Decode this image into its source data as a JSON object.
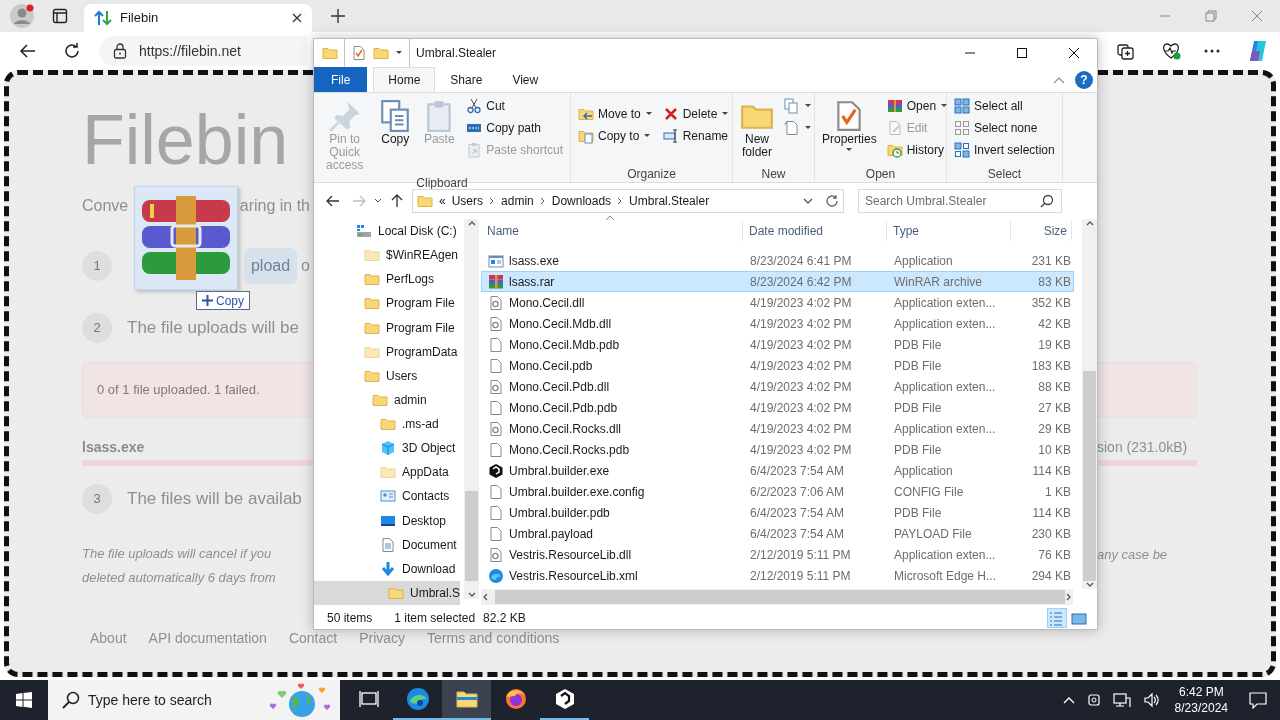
{
  "browser": {
    "tabs": [
      {
        "title": "Filebin",
        "selected": true
      }
    ],
    "url": "https://filebin.net"
  },
  "page": {
    "heading": "Filebin",
    "subtitle": [
      "Conve",
      "aring in th"
    ],
    "step_1": {
      "number": "1",
      "button": "pload",
      "after": "o"
    },
    "step_2": {
      "number": "2",
      "text": "The file uploads will be"
    },
    "error": "0 of 1 file uploaded. 1 failed.",
    "file": {
      "name": "lsass.exe",
      "size": "sion (231.0kB)",
      "level": 1
    },
    "step_3": {
      "number": "3",
      "text": "The files will be availab"
    },
    "note": {
      "lines": [
        "The file uploads will cancel if you",
        "deleted automatically 6 days from"
      ],
      "right": "any case be"
    },
    "footer": [
      "About",
      "API documentation",
      "Contact",
      "Privacy",
      "Terms and conditions"
    ]
  },
  "drag": {
    "label": "Copy"
  },
  "explorer": {
    "title": "Umbral.Stealer",
    "ribbon_tabs": [
      {
        "label": "File",
        "kind": "file",
        "selected": false
      },
      {
        "label": "Home",
        "kind": "tab",
        "selected": true
      },
      {
        "label": "Share",
        "kind": "tab",
        "selected": false
      },
      {
        "label": "View",
        "kind": "tab",
        "selected": false
      }
    ],
    "help": "?",
    "ribbon_groups": [
      {
        "label": "Clipboard",
        "columns": [
          [
            {
              "kind": "large",
              "label": "Pin to Quick access",
              "disabled": true,
              "dropdown": false
            }
          ],
          [
            {
              "kind": "large",
              "label": "Copy",
              "disabled": false,
              "dropdown": false
            }
          ],
          [
            {
              "kind": "large",
              "label": "Paste",
              "disabled": true,
              "dropdown": false
            }
          ],
          [
            {
              "kind": "small",
              "label": "Cut",
              "disabled": false,
              "dropdown": false
            },
            {
              "kind": "small",
              "label": "Copy path",
              "disabled": false,
              "dropdown": false
            },
            {
              "kind": "small",
              "label": "Paste shortcut",
              "disabled": true,
              "dropdown": false
            }
          ]
        ]
      },
      {
        "label": "Organize",
        "columns": [
          [
            {
              "kind": "small",
              "label": "Move to",
              "disabled": false,
              "dropdown": true
            },
            {
              "kind": "small",
              "label": "Copy to",
              "disabled": false,
              "dropdown": true
            }
          ],
          [
            {
              "kind": "small",
              "label": "Delete",
              "disabled": false,
              "dropdown": true
            },
            {
              "kind": "small",
              "label": "Rename",
              "disabled": false,
              "dropdown": false
            }
          ]
        ]
      },
      {
        "label": "New",
        "columns": [
          [
            {
              "kind": "large",
              "label": "New folder",
              "disabled": false,
              "dropdown": false
            }
          ],
          [
            {
              "kind": "small",
              "disabled": false,
              "dropdown": true
            },
            {
              "kind": "small",
              "disabled": false,
              "dropdown": true
            }
          ]
        ]
      },
      {
        "label": "Open",
        "columns": [
          [
            {
              "kind": "large",
              "label": "Properties",
              "disabled": false,
              "dropdown": true
            }
          ],
          [
            {
              "kind": "small",
              "label": "Open",
              "disabled": false,
              "dropdown": true
            },
            {
              "kind": "small",
              "label": "Edit",
              "disabled": true,
              "dropdown": false
            },
            {
              "kind": "small",
              "label": "History",
              "disabled": false,
              "dropdown": false
            }
          ]
        ]
      },
      {
        "label": "Select",
        "columns": [
          [
            {
              "kind": "small",
              "label": "Select all",
              "disabled": false,
              "dropdown": false
            },
            {
              "kind": "small",
              "label": "Select none",
              "disabled": false,
              "dropdown": false
            },
            {
              "kind": "small",
              "label": "Invert selection",
              "disabled": false,
              "dropdown": false
            }
          ]
        ]
      }
    ],
    "address": {
      "overflow": "«",
      "path": [
        "Users",
        "admin",
        "Downloads",
        "Umbral.Stealer"
      ],
      "search_placeholder": "Search Umbral.Stealer"
    },
    "nav_tree": [
      {
        "label": "Local Disk (C:)",
        "kind": "drive",
        "selected": false,
        "children": [
          {
            "label": "$WinREAgen",
            "kind": "hidden-folder",
            "selected": false
          },
          {
            "label": "PerfLogs",
            "kind": "folder",
            "selected": false
          },
          {
            "label": "Program File",
            "kind": "folder",
            "selected": false
          },
          {
            "label": "Program File",
            "kind": "folder",
            "selected": false
          },
          {
            "label": "ProgramData",
            "kind": "hidden-folder",
            "selected": false
          },
          {
            "label": "Users",
            "kind": "folder",
            "selected": false,
            "children": [
              {
                "label": "admin",
                "kind": "folder",
                "selected": false,
                "children": [
                  {
                    "label": ".ms-ad",
                    "kind": "folder",
                    "selected": false
                  },
                  {
                    "label": "3D Object",
                    "kind": "cube",
                    "selected": false
                  },
                  {
                    "label": "AppData",
                    "kind": "hidden-folder",
                    "selected": false
                  },
                  {
                    "label": "Contacts",
                    "kind": "contacts",
                    "selected": false
                  },
                  {
                    "label": "Desktop",
                    "kind": "desktop",
                    "selected": false
                  },
                  {
                    "label": "Document",
                    "kind": "documents",
                    "selected": false
                  },
                  {
                    "label": "Download",
                    "kind": "downloads",
                    "selected": false,
                    "children": [
                      {
                        "label": "Umbral.S",
                        "kind": "folder",
                        "selected": true
                      }
                    ]
                  }
                ]
              }
            ]
          }
        ]
      }
    ],
    "columns": [
      "Name",
      "Date modified",
      "Type",
      "Size"
    ],
    "files": [
      {
        "name": "lsass.exe",
        "date": "8/23/2024 6:41 PM",
        "type": "Application",
        "size": "231 KB",
        "kind": "application",
        "selected": false
      },
      {
        "name": "lsass.rar",
        "date": "8/23/2024 6:42 PM",
        "type": "WinRAR archive",
        "size": "83 KB",
        "kind": "archive",
        "selected": true
      },
      {
        "name": "Mono.Cecil.dll",
        "date": "4/19/2023 4:02 PM",
        "type": "Application exten...",
        "size": "352 KB",
        "kind": "extension",
        "selected": false
      },
      {
        "name": "Mono.Cecil.Mdb.dll",
        "date": "4/19/2023 4:02 PM",
        "type": "Application exten...",
        "size": "42 KB",
        "kind": "extension",
        "selected": false
      },
      {
        "name": "Mono.Cecil.Mdb.pdb",
        "date": "4/19/2023 4:02 PM",
        "type": "PDB File",
        "size": "19 KB",
        "kind": "document",
        "selected": false
      },
      {
        "name": "Mono.Cecil.pdb",
        "date": "4/19/2023 4:02 PM",
        "type": "PDB File",
        "size": "183 KB",
        "kind": "document",
        "selected": false
      },
      {
        "name": "Mono.Cecil.Pdb.dll",
        "date": "4/19/2023 4:02 PM",
        "type": "Application exten...",
        "size": "88 KB",
        "kind": "extension",
        "selected": false
      },
      {
        "name": "Mono.Cecil.Pdb.pdb",
        "date": "4/19/2023 4:02 PM",
        "type": "PDB File",
        "size": "27 KB",
        "kind": "document",
        "selected": false
      },
      {
        "name": "Mono.Cecil.Rocks.dll",
        "date": "4/19/2023 4:02 PM",
        "type": "Application exten...",
        "size": "29 KB",
        "kind": "extension",
        "selected": false
      },
      {
        "name": "Mono.Cecil.Rocks.pdb",
        "date": "4/19/2023 4:02 PM",
        "type": "PDB File",
        "size": "10 KB",
        "kind": "document",
        "selected": false
      },
      {
        "name": "Umbral.builder.exe",
        "date": "6/4/2023 7:54 AM",
        "type": "Application",
        "size": "114 KB",
        "kind": "builder",
        "selected": false
      },
      {
        "name": "Umbral.builder.exe.config",
        "date": "6/2/2023 7:06 AM",
        "type": "CONFIG File",
        "size": "1 KB",
        "kind": "document",
        "selected": false
      },
      {
        "name": "Umbral.builder.pdb",
        "date": "6/4/2023 7:54 AM",
        "type": "PDB File",
        "size": "114 KB",
        "kind": "document",
        "selected": false
      },
      {
        "name": "Umbral.payload",
        "date": "6/4/2023 7:54 AM",
        "type": "PAYLOAD File",
        "size": "230 KB",
        "kind": "document",
        "selected": false
      },
      {
        "name": "Vestris.ResourceLib.dll",
        "date": "2/12/2019 5:11 PM",
        "type": "Application exten...",
        "size": "76 KB",
        "kind": "extension",
        "selected": false
      },
      {
        "name": "Vestris.ResourceLib.xml",
        "date": "2/12/2019 5:11 PM",
        "type": "Microsoft Edge H...",
        "size": "294 KB",
        "kind": "web",
        "selected": false
      }
    ],
    "status": {
      "items": "50 items",
      "selection": "1 item selected",
      "size": "82.2 KB"
    },
    "views": [
      {
        "kind": "details",
        "selected": true
      },
      {
        "kind": "large-icons",
        "selected": false
      }
    ]
  },
  "taskbar": {
    "search_placeholder": "Type here to search",
    "apps": [
      {
        "kind": "edge",
        "running": true,
        "selected": false
      },
      {
        "kind": "explorer",
        "running": true,
        "selected": true
      },
      {
        "kind": "firefox",
        "running": false,
        "selected": false
      },
      {
        "kind": "umbral",
        "running": true,
        "selected": false
      }
    ],
    "time": "6:42 PM",
    "date": "8/23/2024"
  }
}
